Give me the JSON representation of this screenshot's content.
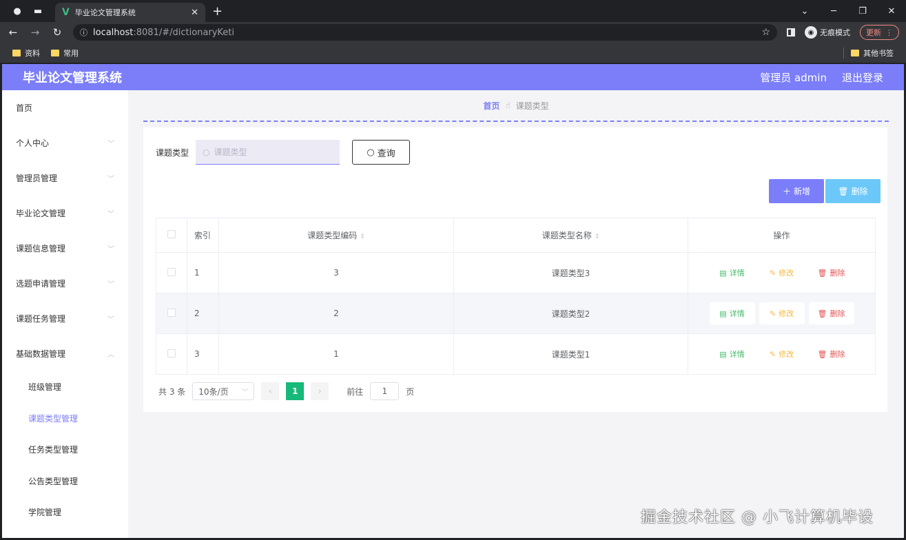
{
  "browser": {
    "tab_title": "毕业论文管理系统",
    "url_host": "localhost",
    "url_path": ":8081/#/dictionaryKeti",
    "incognito_label": "无痕模式",
    "update_label": "更新",
    "bookmarks": [
      "资料",
      "常用"
    ],
    "other_bookmarks": "其他书签"
  },
  "header": {
    "title": "毕业论文管理系统",
    "user": "管理员 admin",
    "logout": "退出登录"
  },
  "sidebar": {
    "items": [
      {
        "label": "首页"
      },
      {
        "label": "个人中心"
      },
      {
        "label": "管理员管理"
      },
      {
        "label": "毕业论文管理"
      },
      {
        "label": "课题信息管理"
      },
      {
        "label": "选题申请管理"
      },
      {
        "label": "课题任务管理"
      },
      {
        "label": "基础数据管理"
      }
    ],
    "sub_items": [
      {
        "label": "班级管理"
      },
      {
        "label": "课题类型管理"
      },
      {
        "label": "任务类型管理"
      },
      {
        "label": "公告类型管理"
      },
      {
        "label": "学院管理"
      }
    ]
  },
  "breadcrumb": {
    "home": "首页",
    "current": "课题类型"
  },
  "search": {
    "label": "课题类型",
    "placeholder": "课题类型",
    "button": "查询"
  },
  "actions": {
    "add": "新增",
    "delete": "删除"
  },
  "table": {
    "headers": {
      "index": "索引",
      "code": "课题类型编码",
      "name": "课题类型名称",
      "ops": "操作"
    },
    "rows": [
      {
        "index": "1",
        "code": "3",
        "name": "课题类型3"
      },
      {
        "index": "2",
        "code": "2",
        "name": "课题类型2"
      },
      {
        "index": "3",
        "code": "1",
        "name": "课题类型1"
      }
    ],
    "op_detail": "详情",
    "op_edit": "修改",
    "op_delete": "删除"
  },
  "pagination": {
    "total": "共 3 条",
    "page_size": "10条/页",
    "current_page": "1",
    "goto_prefix": "前往",
    "goto_value": "1",
    "goto_suffix": "页"
  },
  "watermark": "掘金技术社区 @ 小飞计算机毕设",
  "colors": {
    "primary": "#7b7ef8",
    "info": "#6cc8f8",
    "success": "#43b868",
    "warning": "#f4b942",
    "danger": "#e35555",
    "page_active": "#17b978"
  }
}
